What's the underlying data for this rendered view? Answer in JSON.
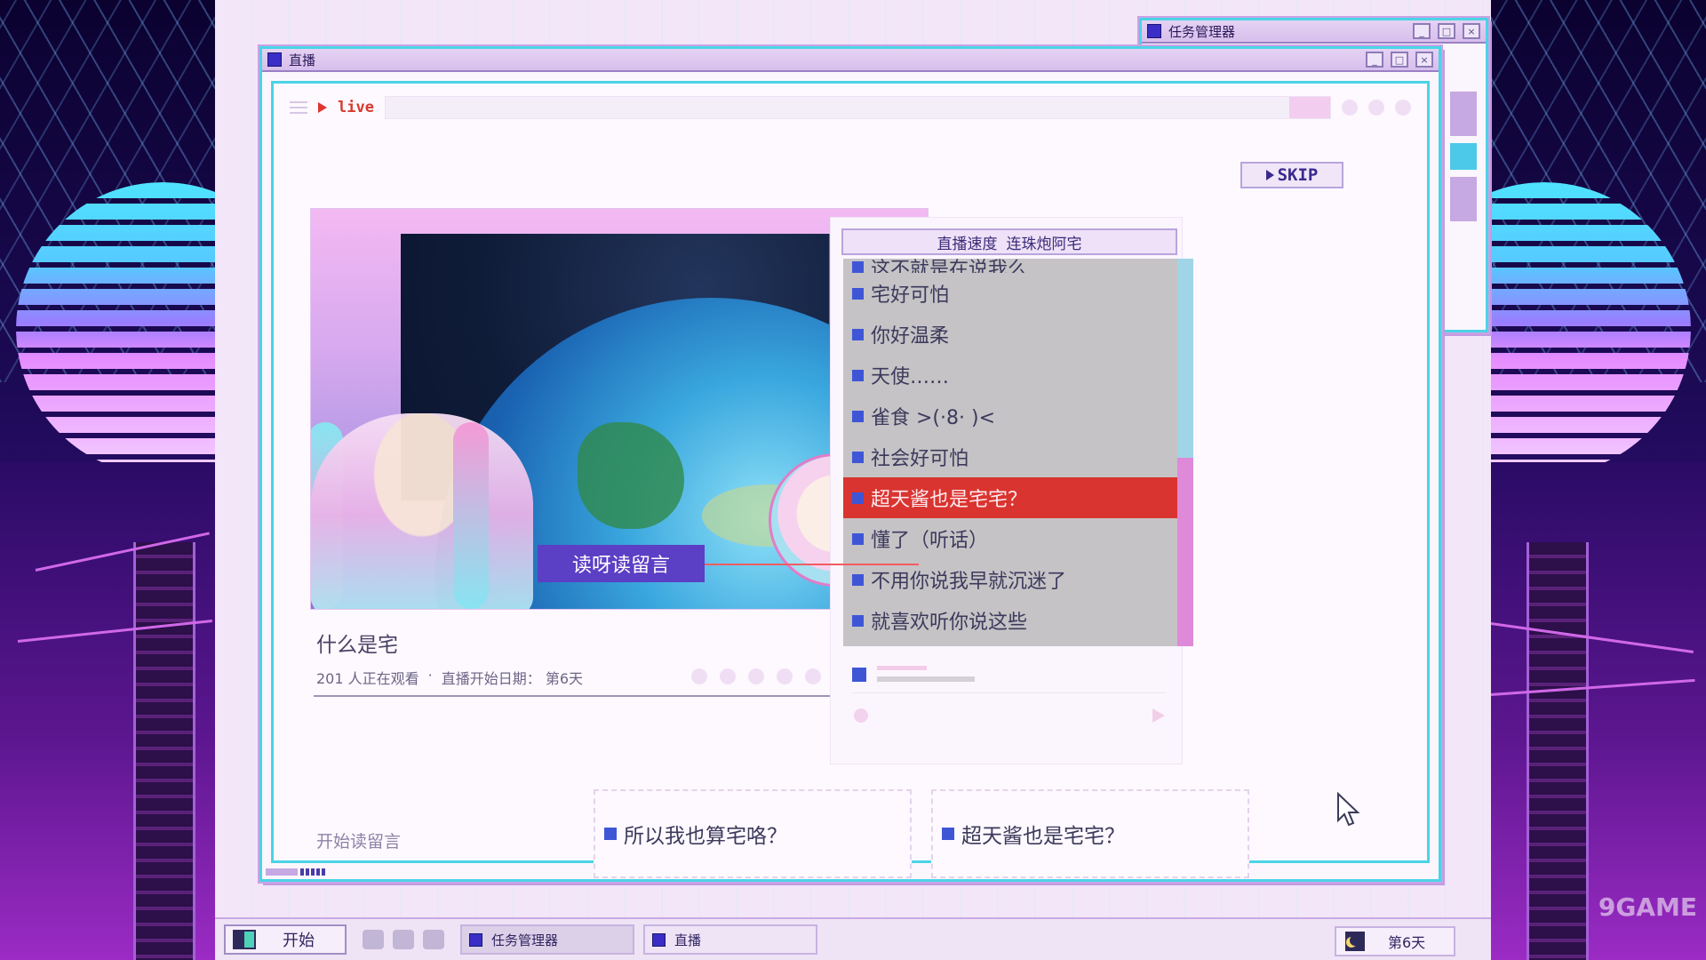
{
  "windows": {
    "task_manager": {
      "title": "任务管理器"
    },
    "stream": {
      "title": "直播"
    }
  },
  "address_bar": {
    "live_label": "live"
  },
  "skip_label": "SKIP",
  "video": {
    "caption": "读呀读留言"
  },
  "stream_info": {
    "title": "什么是宅",
    "viewers": "201 人正在观看",
    "separator": "·",
    "start_date": "直播开始日期：  第6天"
  },
  "chat": {
    "header_left": "直播速度",
    "header_right": "连珠炮阿宅",
    "items": [
      {
        "text": "这不就是在说我么"
      },
      {
        "text": "宅好可怕"
      },
      {
        "text": "你好温柔"
      },
      {
        "text": "天使……"
      },
      {
        "text": "雀食 >(·8· )<"
      },
      {
        "text": "社会好可怕"
      },
      {
        "text": "超天酱也是宅宅？"
      },
      {
        "text": "懂了（听话）"
      },
      {
        "text": "不用你说我早就沉迷了"
      },
      {
        "text": "就喜欢听你说这些"
      }
    ],
    "highlighted_index": 6
  },
  "reply": {
    "start_label": "开始读留言",
    "options": [
      {
        "text": "所以我也算宅咯？"
      },
      {
        "text": "超天酱也是宅宅？"
      }
    ]
  },
  "taskbar": {
    "start_label": "开始",
    "tasks": [
      {
        "title": "任务管理器"
      },
      {
        "title": "直播"
      }
    ],
    "day": "第6天"
  },
  "watermark": "9GAME",
  "colors": {
    "accent_cyan": "#4ad4e6",
    "highlight_red": "#d9342f",
    "chat_bullet": "#3e56d6",
    "caption_bg": "#5b3fc4"
  }
}
